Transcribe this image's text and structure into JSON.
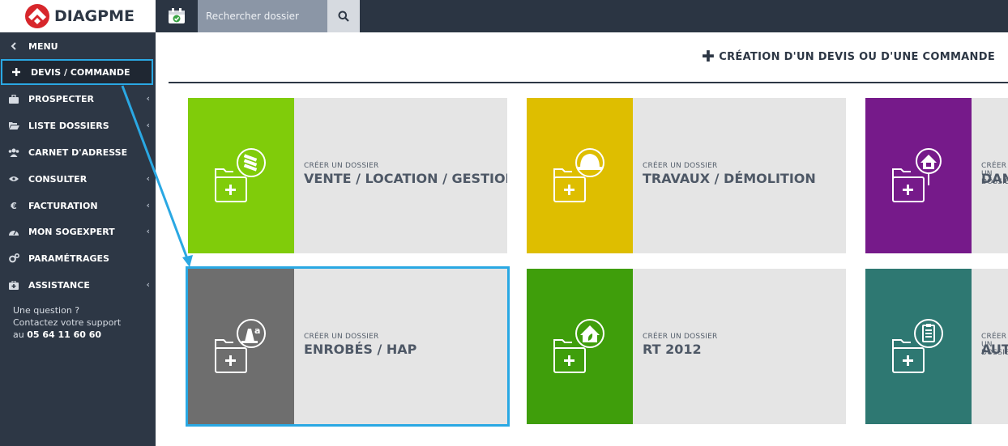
{
  "brand": {
    "name": "DIAGPME"
  },
  "search": {
    "placeholder": "Rechercher dossier"
  },
  "sidebar": {
    "items": [
      {
        "label": "MENU",
        "icon": "chevron-left-icon"
      },
      {
        "label": "DEVIS / COMMANDE",
        "icon": "plus-icon",
        "active": true
      },
      {
        "label": "PROSPECTER",
        "icon": "briefcase-icon",
        "submenu": true
      },
      {
        "label": "LISTE DOSSIERS",
        "icon": "folder-open-icon",
        "submenu": true
      },
      {
        "label": "CARNET D'ADRESSE",
        "icon": "users-icon",
        "submenu": false
      },
      {
        "label": "CONSULTER",
        "icon": "eye-icon",
        "submenu": true
      },
      {
        "label": "FACTURATION",
        "icon": "euro-icon",
        "submenu": true
      },
      {
        "label": "MON SOGEXPERT",
        "icon": "dashboard-icon",
        "submenu": true
      },
      {
        "label": "PARAMÉTRAGES",
        "icon": "gears-icon",
        "submenu": false
      },
      {
        "label": "ASSISTANCE",
        "icon": "first-aid-icon",
        "submenu": true
      }
    ],
    "support": {
      "line1": "Une question ?",
      "line2": "Contactez votre support",
      "prefix": "au",
      "phone": "05 64 11 60 60"
    }
  },
  "main": {
    "heading": "CRÉATION D'UN DEVIS OU D'UNE COMMANDE",
    "cards": [
      {
        "sub": "CRÉER UN DOSSIER",
        "title": "VENTE / LOCATION / GESTION",
        "color": "#80cc0a",
        "icon": "folder-sale-icon"
      },
      {
        "sub": "CRÉER UN DOSSIER",
        "title": "TRAVAUX / DÉMOLITION",
        "color": "#debe00",
        "icon": "folder-hardhat-icon"
      },
      {
        "sub": "CRÉER UN DOSSIER",
        "title": "DAN",
        "color": "#761a8a",
        "icon": "folder-house-plug-icon"
      },
      {
        "sub": "CRÉER UN DOSSIER",
        "title": "ENROBÉS / HAP",
        "color": "#6e6e6e",
        "icon": "folder-road-cone-icon",
        "selected": true
      },
      {
        "sub": "CRÉER UN DOSSIER",
        "title": "RT 2012",
        "color": "#3f9e0b",
        "icon": "folder-eco-house-icon"
      },
      {
        "sub": "CRÉER UN DOSSIER",
        "title": "AUT",
        "color": "#2e7872",
        "icon": "folder-checklist-icon"
      }
    ]
  },
  "colors": {
    "accent": "#2aa8e3",
    "sidebar": "#2d3745",
    "topbar": "#2b3543"
  }
}
